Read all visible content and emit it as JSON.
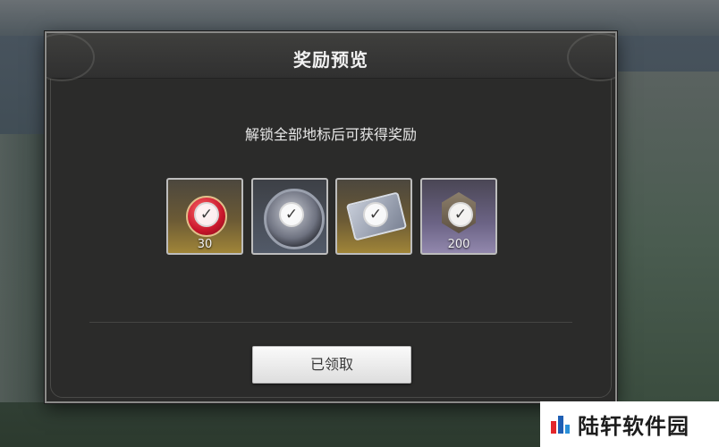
{
  "dialog": {
    "title": "奖励预览",
    "subtitle": "解锁全部地标后可获得奖励",
    "rewards": [
      {
        "icon": "red-medal-icon",
        "quantity": "30",
        "rarity": "gold",
        "claimed": true
      },
      {
        "icon": "gear-emblem-icon",
        "quantity": "",
        "rarity": "gold",
        "claimed": true
      },
      {
        "icon": "card-icon",
        "quantity": "",
        "rarity": "gold",
        "claimed": true
      },
      {
        "icon": "badge-icon",
        "quantity": "200",
        "rarity": "purple",
        "claimed": true
      }
    ],
    "claim_button_label": "已领取",
    "check_glyph": "✓"
  },
  "watermark": {
    "text": "陆轩软件园"
  },
  "colors": {
    "dialog_bg": "#2b2b2a",
    "gold_frame": "#a08538",
    "purple_frame": "#9288ad"
  }
}
